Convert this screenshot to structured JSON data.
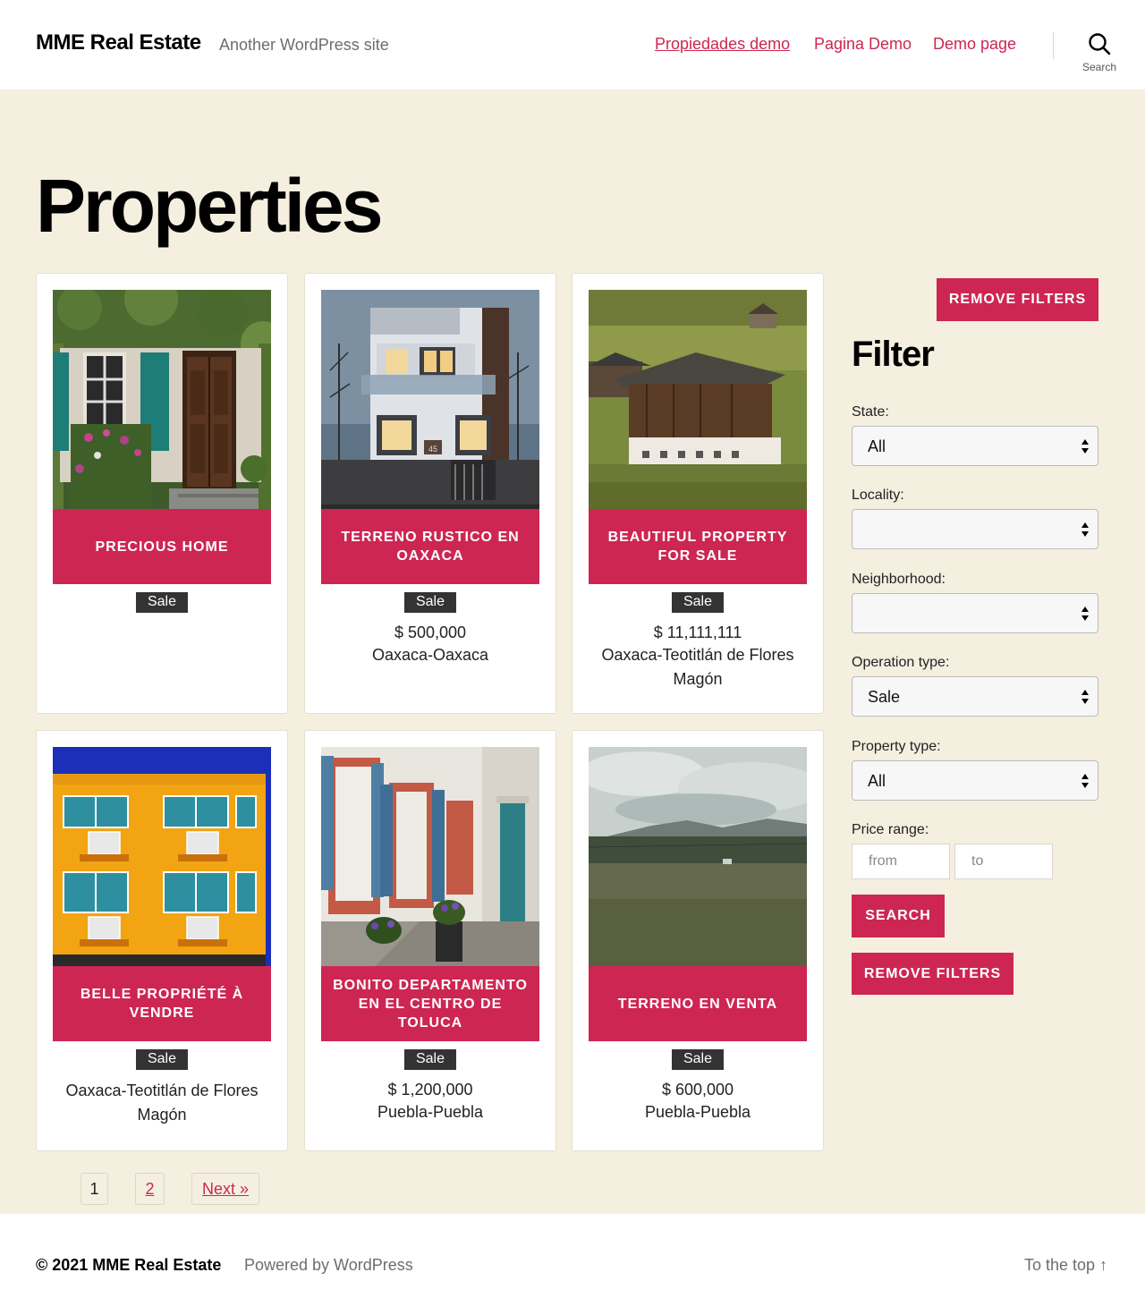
{
  "header": {
    "site_title": "MME Real Estate",
    "site_description": "Another WordPress site",
    "nav": [
      "Propiedades demo",
      "Pagina Demo",
      "Demo page"
    ],
    "search_label": "Search"
  },
  "page_title": "Properties",
  "properties": [
    {
      "title": "PRECIOUS HOME",
      "operation": "Sale",
      "price": "",
      "location": ""
    },
    {
      "title": "TERRENO RUSTICO EN OAXACA",
      "operation": "Sale",
      "price": "$ 500,000",
      "location": "Oaxaca-Oaxaca"
    },
    {
      "title": "BEAUTIFUL PROPERTY FOR SALE",
      "operation": "Sale",
      "price": "$ 11,111,111",
      "location": "Oaxaca-Teotitlán de Flores Magón"
    },
    {
      "title": "BELLE PROPRIÉTÉ À VENDRE",
      "operation": "Sale",
      "price": "",
      "location": "Oaxaca-Teotitlán de Flores Magón"
    },
    {
      "title": "BONITO DEPARTAMENTO EN EL CENTRO DE TOLUCA",
      "operation": "Sale",
      "price": "$ 1,200,000",
      "location": "Puebla-Puebla"
    },
    {
      "title": "TERRENO EN VENTA",
      "operation": "Sale",
      "price": "$ 600,000",
      "location": "Puebla-Puebla"
    }
  ],
  "sidebar": {
    "remove_filters_top": "REMOVE FILTERS",
    "filter_title": "Filter",
    "state_label": "State:",
    "state_value": "All",
    "locality_label": "Locality:",
    "locality_value": "",
    "neighborhood_label": "Neighborhood:",
    "neighborhood_value": "",
    "operation_label": "Operation type:",
    "operation_value": "Sale",
    "property_type_label": "Property type:",
    "property_type_value": "All",
    "price_range_label": "Price range:",
    "price_from_placeholder": "from",
    "price_to_placeholder": "to",
    "search_button": "SEARCH",
    "remove_filters_bottom": "REMOVE FILTERS"
  },
  "pagination": {
    "current": "1",
    "page2": "2",
    "next": "Next »"
  },
  "footer": {
    "copyright": "© 2021 MME Real Estate",
    "powered": "Powered by WordPress",
    "to_top": "To the top ↑"
  },
  "colors": {
    "accent": "#cd2653",
    "background": "#f5efe0",
    "badge": "#333333"
  }
}
